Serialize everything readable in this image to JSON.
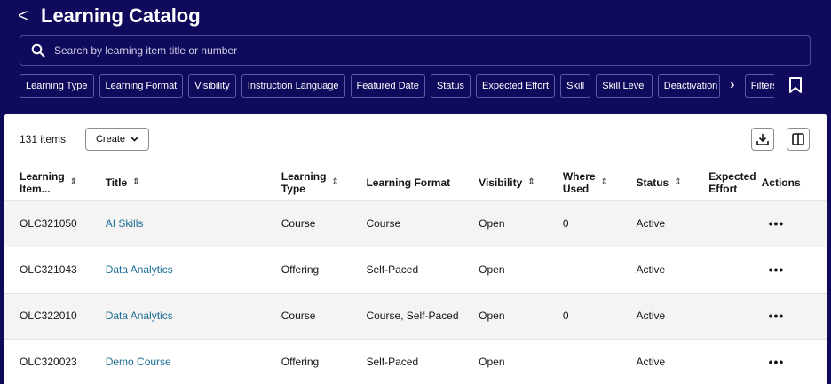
{
  "header": {
    "title": "Learning Catalog",
    "back_label": "<"
  },
  "search": {
    "placeholder": "Search by learning item title or number",
    "value": ""
  },
  "filters": {
    "chips": [
      "Learning Type",
      "Learning Format",
      "Visibility",
      "Instruction Language",
      "Featured Date",
      "Status",
      "Expected Effort",
      "Skill",
      "Skill Level",
      "Deactivation I"
    ],
    "more_label": "Filters"
  },
  "toolbar": {
    "count_label": "131 items",
    "create_label": "Create"
  },
  "table": {
    "columns": {
      "number": [
        "Learning",
        "Item..."
      ],
      "title": "Title",
      "type": [
        "Learning",
        "Type"
      ],
      "format": "Learning Format",
      "visibility": "Visibility",
      "where_used": [
        "Where",
        "Used"
      ],
      "status": "Status",
      "effort": [
        "Expected",
        "Effort"
      ],
      "actions": "Actions"
    },
    "rows": [
      {
        "number": "OLC321050",
        "title": "AI Skills",
        "type": "Course",
        "format": "Course",
        "visibility": "Open",
        "where_used": "0",
        "status": "Active",
        "effort": ""
      },
      {
        "number": "OLC321043",
        "title": "Data Analytics",
        "type": "Offering",
        "format": "Self-Paced",
        "visibility": "Open",
        "where_used": "",
        "status": "Active",
        "effort": ""
      },
      {
        "number": "OLC322010",
        "title": "Data Analytics",
        "type": "Course",
        "format": "Course, Self-Paced",
        "visibility": "Open",
        "where_used": "0",
        "status": "Active",
        "effort": ""
      },
      {
        "number": "OLC320023",
        "title": "Demo Course",
        "type": "Offering",
        "format": "Self-Paced",
        "visibility": "Open",
        "where_used": "",
        "status": "Active",
        "effort": ""
      }
    ],
    "actions_glyph": "•••"
  },
  "colors": {
    "header_bg": "#0f0a5c",
    "link": "#1b6e96",
    "alt_row": "#f5f4f2"
  }
}
